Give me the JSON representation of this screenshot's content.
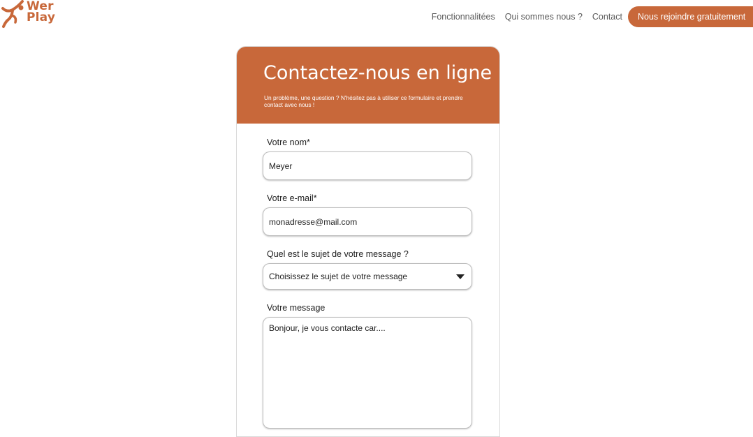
{
  "logo": {
    "line1": "Wer",
    "line2": "Play",
    "brand_color": "#c8683a",
    "icon": "runner-logo-icon"
  },
  "nav": {
    "links": [
      "Fonctionnalitées",
      "Qui sommes nous ?",
      "Contact"
    ],
    "cta": "Nous rejoindre gratuitement"
  },
  "card": {
    "title": "Contactez-nous en ligne",
    "subtitle": "Un problème, une question ? N'hésitez pas à utiliser ce formulaire et prendre contact avec nous !"
  },
  "form": {
    "name_label": "Votre nom*",
    "name_value": "Meyer",
    "email_label": "Votre e-mail*",
    "email_value": "monadresse@mail.com",
    "subject_label": "Quel est le sujet de votre message ?",
    "subject_value": "Choisissez le sujet de votre message",
    "message_label": "Votre message",
    "message_value": "Bonjour, je vous contacte car...."
  }
}
